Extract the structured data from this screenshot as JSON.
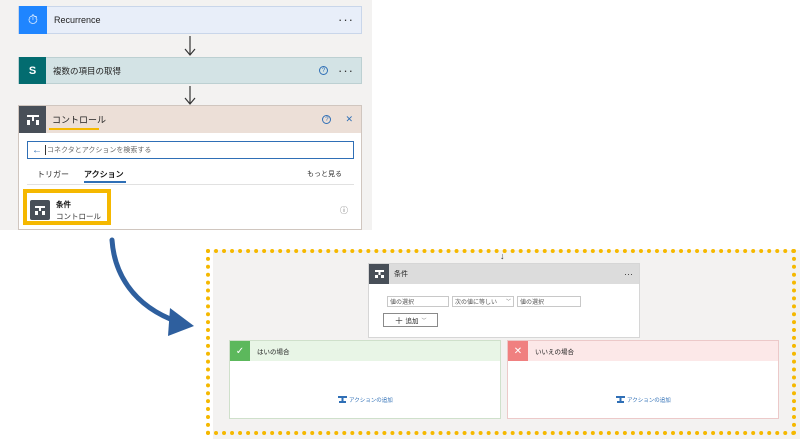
{
  "flow": {
    "recurrence": {
      "title": "Recurrence",
      "more": "···",
      "color": "#e8eef9",
      "icon_color": "#1f85ff"
    },
    "get_items": {
      "title": "複数の項目の取得",
      "help": "?",
      "more": "···",
      "color": "#d3e3e5",
      "icon_color": "#036c70"
    },
    "control": {
      "title": "コントロール",
      "help": "?",
      "close": "✕",
      "color": "#ecdfd7",
      "icon_color": "#484f58",
      "search_placeholder": "コネクタとアクションを検索する",
      "tabs": [
        "トリガー",
        "アクション"
      ],
      "active_tab": "アクション",
      "see_more": "もっと見る",
      "result": {
        "title": "条件",
        "subtitle": "コントロール",
        "info": "ⓘ"
      }
    }
  },
  "condition": {
    "title": "条件",
    "more": "···",
    "value_placeholder_1": "値の選択",
    "operator": "次の値に等しい",
    "value_placeholder_2": "値の選択",
    "add_button": "追加",
    "yes_branch": {
      "title": "はいの場合",
      "add_action": "アクションの追加",
      "color": "#e8f5e6",
      "icon_color": "#5cb85c"
    },
    "no_branch": {
      "title": "いいえの場合",
      "add_action": "アクションの追加",
      "color": "#fce8e8",
      "icon_color": "#f08080"
    }
  },
  "colors": {
    "highlight": "#f5b800",
    "arrow": "#2e5f9e",
    "search_border": "#2f6fb6"
  }
}
